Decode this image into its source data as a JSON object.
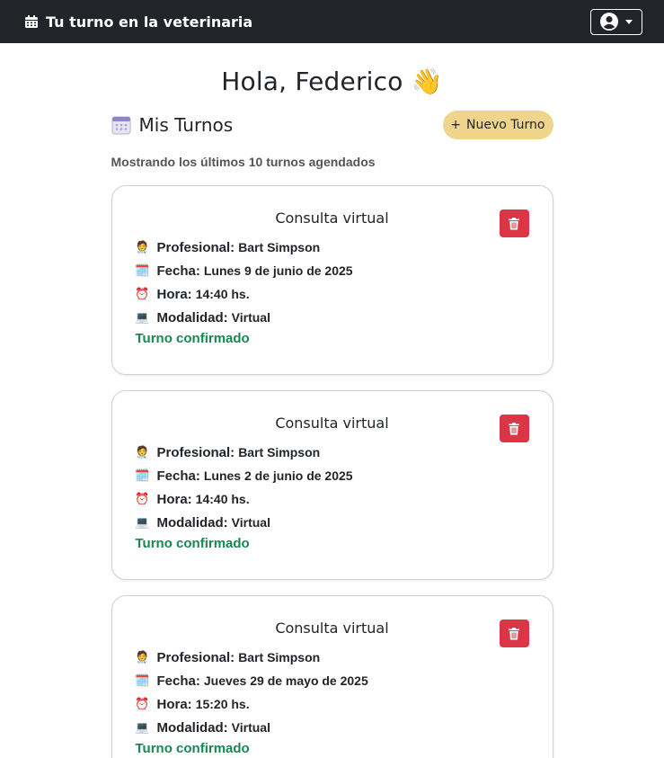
{
  "navbar": {
    "brand_icon": "calendar-icon",
    "brand": "Tu turno en la veterinaria",
    "user_icon": "user-circle-icon"
  },
  "greeting": "Hola, Federico 👋",
  "section": {
    "icon": "calendar-icon",
    "title": "Mis Turnos",
    "new_button_icon": "plus-icon",
    "new_button": "Nuevo Turno",
    "subtitle": "Mostrando los últimos 10 turnos agendados"
  },
  "labels": {
    "profesional": "Profesional:",
    "fecha": "Fecha:",
    "hora": "Hora:",
    "modalidad": "Modalidad:"
  },
  "cards": [
    {
      "title": "Consulta virtual",
      "profesional": "Bart Simpson",
      "fecha": "Lunes 9 de junio de 2025",
      "hora": "14:40 hs.",
      "modalidad": "Virtual",
      "status": "Turno confirmado"
    },
    {
      "title": "Consulta virtual",
      "profesional": "Bart Simpson",
      "fecha": "Lunes 2 de junio de 2025",
      "hora": "14:40 hs.",
      "modalidad": "Virtual",
      "status": "Turno confirmado"
    },
    {
      "title": "Consulta virtual",
      "profesional": "Bart Simpson",
      "fecha": "Jueves 29 de mayo de 2025",
      "hora": "15:20 hs.",
      "modalidad": "Virtual",
      "status": "Turno confirmado"
    }
  ],
  "colors": {
    "navbar": "#212529",
    "accent": "#efd58c",
    "danger": "#dc3545",
    "success": "#198754"
  }
}
